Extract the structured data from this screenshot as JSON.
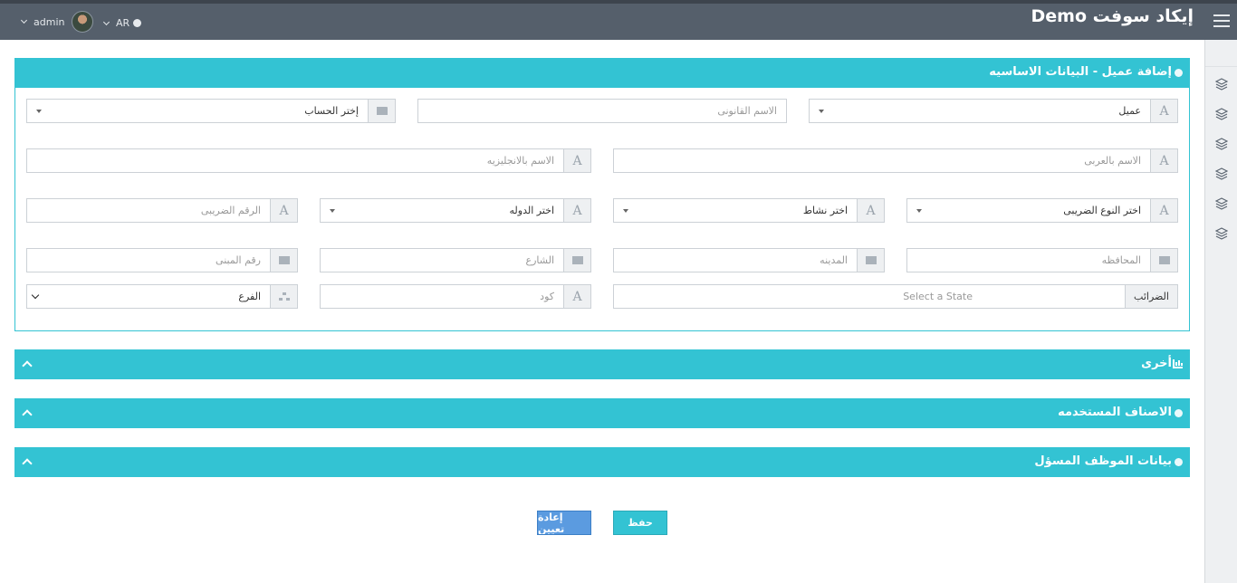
{
  "header": {
    "brand": "إيكاد سوفت Demo",
    "user": "admin",
    "language": "AR"
  },
  "panels": {
    "basic": {
      "title": "إضافة عميل - البيانات الاساسيه"
    },
    "other": {
      "title": "أخرى"
    },
    "categories": {
      "title": "الاصناف المستخدمه"
    },
    "staff": {
      "title": "بيانات الموظف المسؤل"
    }
  },
  "form": {
    "customer_type": "عميل",
    "legal_name_placeholder": "الاسم القانونى",
    "account_select": "إختر الحساب",
    "arabic_name_placeholder": "الاسم بالعربى",
    "english_name_placeholder": "الاسم بالانجليزيه",
    "tax_type_select": "اختر النوع الضريبى",
    "activity_select": "اختر نشاط",
    "country_select": "اختر الدوله",
    "tax_number_placeholder": "الرقم الضريبى",
    "governorate_placeholder": "المحافظه",
    "city_placeholder": "المدينه",
    "street_placeholder": "الشارع",
    "building_placeholder": "رقم المبنى",
    "taxes_label": "الضرائب",
    "state_placeholder": "Select a State",
    "code_placeholder": "كود",
    "branch_select": "الفرع"
  },
  "actions": {
    "save": "حفظ",
    "reset": "إعادة تعيين"
  },
  "colors": {
    "accent": "#33c3d3",
    "topbar": "#555f6b",
    "reset_button": "#5b9be0"
  }
}
